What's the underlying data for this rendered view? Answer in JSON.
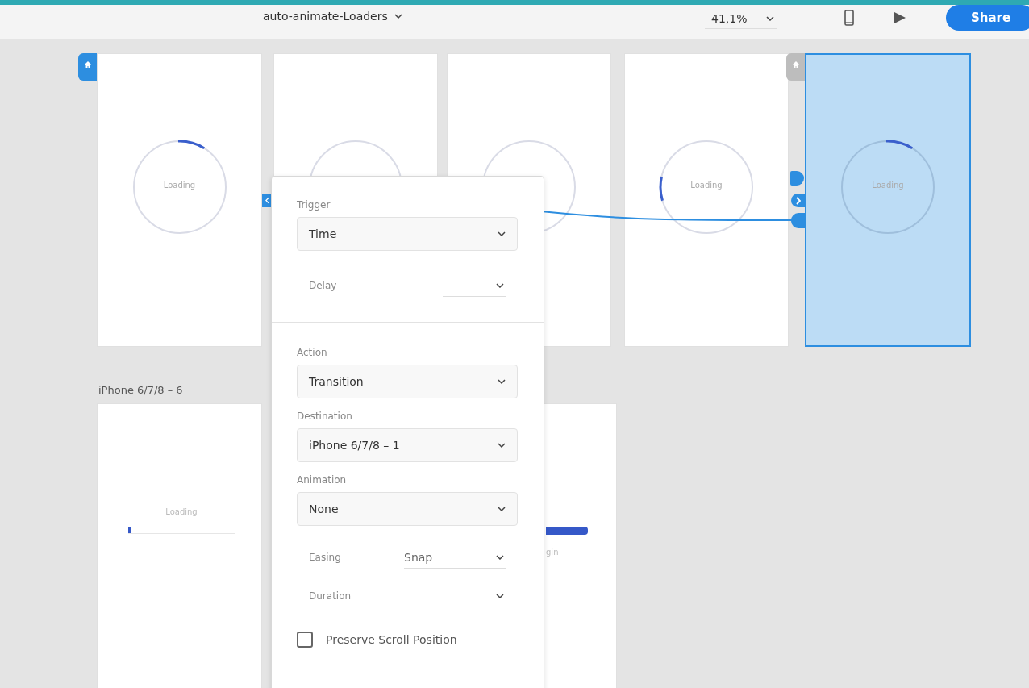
{
  "document": {
    "title": "auto-animate-Loaders"
  },
  "toolbar": {
    "zoom": "41,1%",
    "share_label": "Share"
  },
  "artboards": [
    {
      "selected": false,
      "home": {
        "selected": true
      },
      "loader": {
        "kind": "spinner",
        "label": "Loading"
      }
    },
    {
      "selected": false,
      "loader": {
        "kind": "ring"
      }
    },
    {
      "selected": false,
      "loader": {
        "kind": "ring"
      }
    },
    {
      "selected": false,
      "loader": {
        "kind": "spinnerleft",
        "label": "Loading"
      }
    },
    {
      "selected": true,
      "home": {
        "selected": false
      },
      "loader": {
        "kind": "spinner",
        "label": "Loading"
      }
    },
    {
      "selected": false,
      "name": "iPhone 6/7/8 – 6",
      "loader": {
        "kind": "bar",
        "level": 0.02,
        "label": "Loading"
      }
    },
    {
      "selected": false,
      "loader": {
        "kind": "bar",
        "caption": "gin"
      }
    }
  ],
  "interaction_panel": {
    "trigger": {
      "label": "Trigger",
      "value": "Time"
    },
    "delay": {
      "label": "Delay"
    },
    "action": {
      "label": "Action",
      "value": "Transition"
    },
    "destination": {
      "label": "Destination",
      "value": "iPhone 6/7/8 – 1"
    },
    "animation": {
      "label": "Animation",
      "value": "None"
    },
    "easing": {
      "label": "Easing",
      "value": "Snap"
    },
    "duration": {
      "label": "Duration"
    },
    "preserve_scroll": {
      "label": "Preserve Scroll Position",
      "checked": false
    }
  }
}
